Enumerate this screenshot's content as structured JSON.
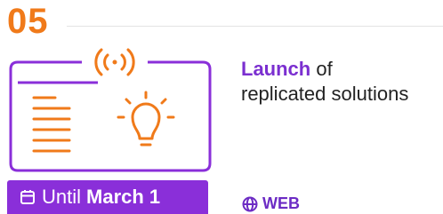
{
  "step": {
    "number": "05"
  },
  "description": {
    "highlight": "Launch",
    "rest_first_line": " of",
    "second_line": "replicated solutions"
  },
  "badge": {
    "prefix": "Until",
    "date": "March 1"
  },
  "link": {
    "label": "WEB"
  },
  "icons": {
    "calendar": "calendar-icon",
    "globe": "globe-icon",
    "signal": "broadcast-icon",
    "bulb": "lightbulb-icon",
    "document": "text-lines-icon"
  },
  "colors": {
    "orange": "#f07a1a",
    "purple": "#8a2fd9",
    "link": "#6c2bc4"
  }
}
